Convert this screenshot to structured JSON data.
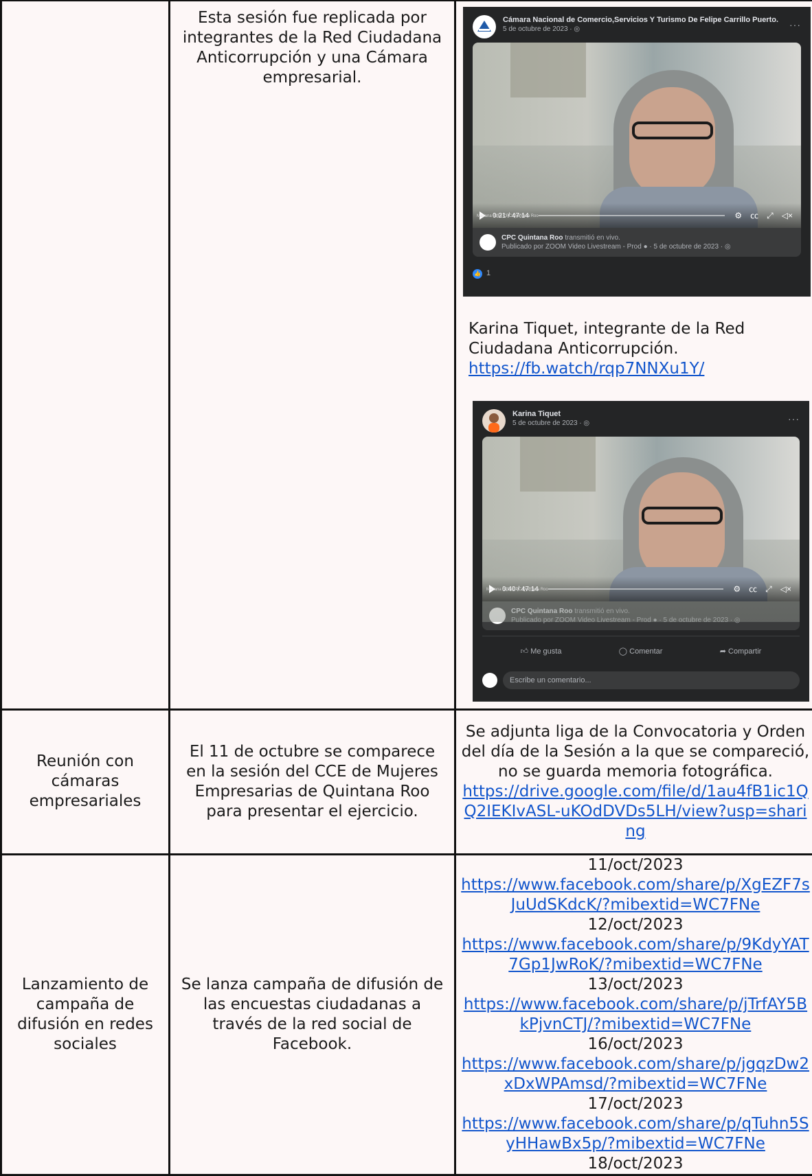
{
  "row1": {
    "col2": "Esta sesión fue replicada por integrantes de la Red Ciudadana Anticorrupción y una Cámara empresarial.",
    "embed1": {
      "page_name": "Cámara Nacional de Comercio,Servicios Y Turismo De Felipe Carrillo Puerto.",
      "date": "5 de octubre de 2023 · ◎",
      "time": "0:21 / 47:14",
      "caption": "Mariana Bellá CPC Quintana Roo",
      "live_name": "CPC Quintana Roo",
      "live_text": "transmitió en vivo.",
      "published": "Publicado por ZOOM Video Livestream - Prod ● · 5 de octubre de 2023 · ◎",
      "likes": "1"
    },
    "karina_text": "Karina Tiquet, integrante de la Red Ciudadana Anticorrupción.",
    "karina_link": "https://fb.watch/rqp7NNXu1Y/",
    "embed2": {
      "page_name": "Karina Tiquet",
      "date": "5 de octubre de 2023 · ◎",
      "time": "0:40 / 47:14",
      "caption": "Mariana Bellá CPC Quintana Roo",
      "live_name": "CPC Quintana Roo",
      "live_text": "transmitió en vivo.",
      "published": "Publicado por ZOOM Video Livestream - Prod ● · 5 de octubre de 2023 · ◎",
      "like_label": "Me gusta",
      "comment_label": "Comentar",
      "share_label": "Compartir",
      "comment_placeholder": "Escribe un comentario..."
    }
  },
  "row2": {
    "col1": "Reunión con cámaras empresariales",
    "col2": "El 11 de octubre se comparece en la sesión del CCE de Mujeres Empresarias de Quintana Roo para presentar el ejercicio.",
    "col3_text": "Se adjunta liga de la Convocatoria y Orden del día de la Sesión a la que se compareció, no se guarda memoria fotográfica.",
    "col3_link": "https://drive.google.com/file/d/1au4fB1ic1QQ2IEKIvASL-uKOdDVDs5LH/view?usp=sharing"
  },
  "row3": {
    "col1": "Lanzamiento de campaña de difusión en redes sociales",
    "col2": "Se lanza campaña de difusión de las encuestas ciudadanas a través de la red social de Facebook.",
    "entries": [
      {
        "date": "11/oct/2023",
        "link": "https://www.facebook.com/share/p/XgEZF7sJuUdSKdcK/?mibextid=WC7FNe"
      },
      {
        "date": "12/oct/2023",
        "link": "https://www.facebook.com/share/p/9KdyYAT7Gp1JwRoK/?mibextid=WC7FNe"
      },
      {
        "date": "13/oct/2023",
        "link": "https://www.facebook.com/share/p/jTrfAY5BkPjvnCTJ/?mibextid=WC7FNe"
      },
      {
        "date": "16/oct/2023",
        "link": "https://www.facebook.com/share/p/jgqzDw2xDxWPAmsd/?mibextid=WC7FNe"
      },
      {
        "date": "17/oct/2023",
        "link": "https://www.facebook.com/share/p/qTuhn5SyHHawBx5p/?mibextid=WC7FNe"
      },
      {
        "date": "18/oct/2023"
      }
    ]
  }
}
